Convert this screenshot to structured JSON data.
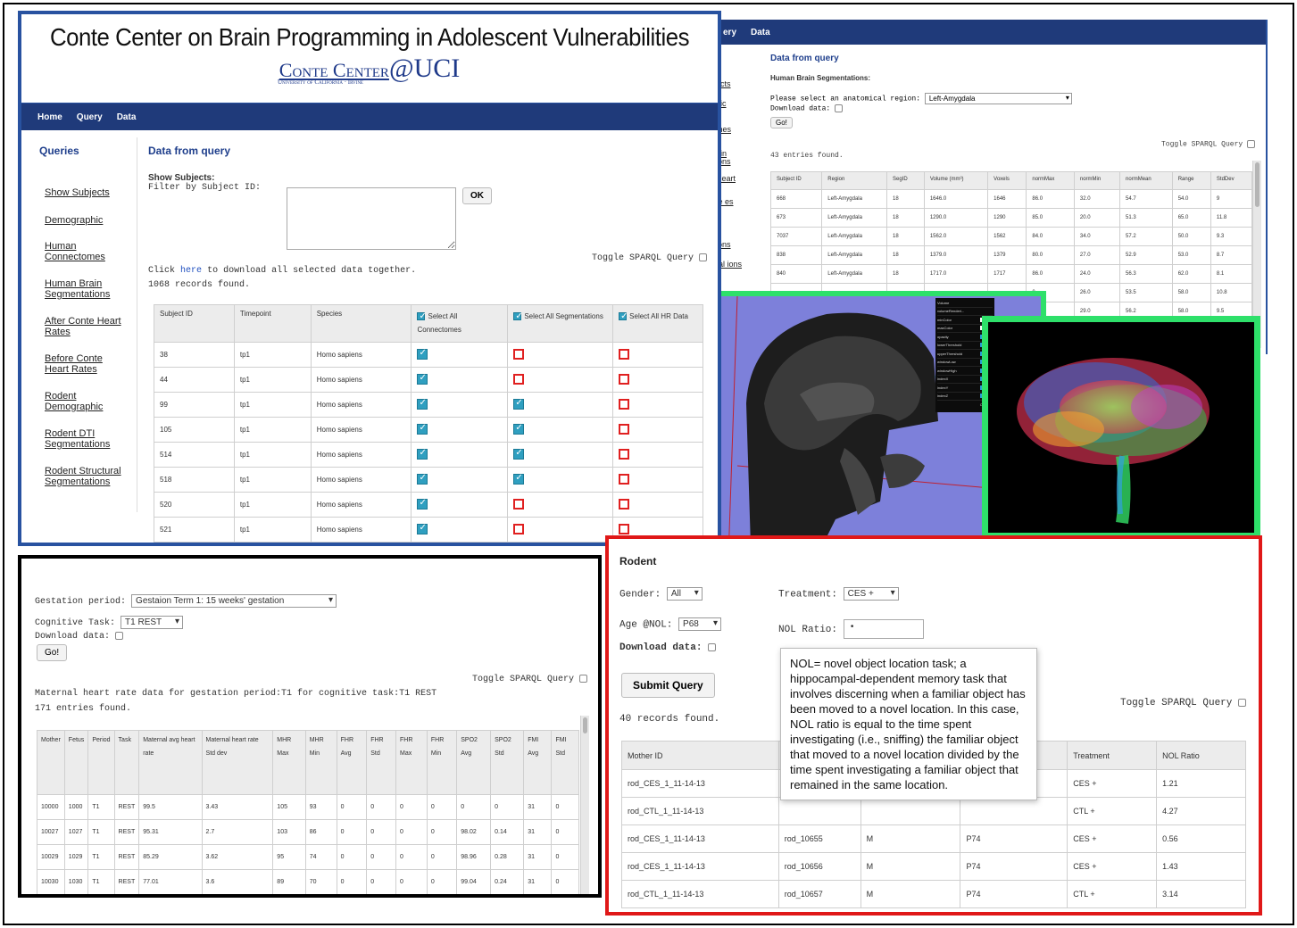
{
  "conte": {
    "title": "Conte Center on Brain Programming in Adolescent Vulnerabilities",
    "logo_conte": "Conte Center",
    "logo_uci": "@UCI",
    "logo_sub": "University of California · Irvine",
    "nav": [
      "Home",
      "Query",
      "Data"
    ],
    "sidebar_title": "Queries",
    "sidebar_items": [
      "Show Subjects",
      "Demographic",
      "Human Connectomes",
      "Human Brain Segmentations",
      "After Conte Heart Rates",
      "Before Conte Heart Rates",
      "Rodent Demographic",
      "Rodent DTI Segmentations",
      "Rodent Structural Segmentations"
    ],
    "heading": "Data from query",
    "show_subjects": "Show Subjects:",
    "filter_label": "Filter by Subject ID:",
    "ok_label": "OK",
    "toggle_sparql": "Toggle SPARQL Query",
    "click_prefix": "Click",
    "click_link": "here",
    "click_suffix": "to download all selected data together.",
    "records_found": "1068 records found.",
    "columns": [
      "Subject ID",
      "Timepoint",
      "Species"
    ],
    "select_all": [
      "Select All Connectomes",
      "Select All Segmentations",
      "Select All HR Data"
    ],
    "rows": [
      {
        "id": "38",
        "tp": "tp1",
        "species": "Homo sapiens",
        "c": true,
        "s": false,
        "h": false
      },
      {
        "id": "44",
        "tp": "tp1",
        "species": "Homo sapiens",
        "c": true,
        "s": false,
        "h": false
      },
      {
        "id": "99",
        "tp": "tp1",
        "species": "Homo sapiens",
        "c": true,
        "s": true,
        "h": false
      },
      {
        "id": "105",
        "tp": "tp1",
        "species": "Homo sapiens",
        "c": true,
        "s": true,
        "h": false
      },
      {
        "id": "514",
        "tp": "tp1",
        "species": "Homo sapiens",
        "c": true,
        "s": true,
        "h": false
      },
      {
        "id": "518",
        "tp": "tp1",
        "species": "Homo sapiens",
        "c": true,
        "s": true,
        "h": false
      },
      {
        "id": "520",
        "tp": "tp1",
        "species": "Homo sapiens",
        "c": true,
        "s": false,
        "h": false
      },
      {
        "id": "521",
        "tp": "tp1",
        "species": "Homo sapiens",
        "c": true,
        "s": false,
        "h": false
      }
    ]
  },
  "seg": {
    "nav": [
      "ery",
      "Data"
    ],
    "side_fragments": [
      "ects",
      "hic",
      "mes",
      "ain ions",
      "Heart",
      "te es",
      "ions",
      "ral ions"
    ],
    "heading": "Data from query",
    "subheading": "Human Brain Segmentations:",
    "region_label": "Please select an anatomical region:",
    "region_value": "Left-Amygdala",
    "download_label": "Download data:",
    "go_label": "Go!",
    "toggle_sparql": "Toggle SPARQL Query",
    "entries_found": "43 entries found.",
    "columns": [
      "Subject ID",
      "Region",
      "SegID",
      "Volume (mm³)",
      "Voxels",
      "normMax",
      "normMin",
      "normMean",
      "Range",
      "StdDev"
    ],
    "rows": [
      [
        "668",
        "Left-Amygdala",
        "18",
        "1646.0",
        "1646",
        "86.0",
        "32.0",
        "54.7",
        "54.0",
        "9"
      ],
      [
        "673",
        "Left-Amygdala",
        "18",
        "1290.0",
        "1290",
        "85.0",
        "20.0",
        "51.3",
        "65.0",
        "11.8"
      ],
      [
        "7037",
        "Left-Amygdala",
        "18",
        "1562.0",
        "1562",
        "84.0",
        "34.0",
        "57.2",
        "50.0",
        "9.3"
      ],
      [
        "838",
        "Left-Amygdala",
        "18",
        "1379.0",
        "1379",
        "80.0",
        "27.0",
        "52.9",
        "53.0",
        "8.7"
      ],
      [
        "840",
        "Left-Amygdala",
        "18",
        "1717.0",
        "1717",
        "86.0",
        "24.0",
        "56.3",
        "62.0",
        "8.1"
      ],
      [
        "",
        "",
        "",
        "",
        "",
        "0",
        "26.0",
        "53.5",
        "58.0",
        "10.8"
      ],
      [
        "",
        "",
        "",
        "",
        "",
        "0",
        "29.0",
        "56.2",
        "58.0",
        "9.5"
      ]
    ]
  },
  "viewer": {
    "panel_items": [
      "Volume",
      "volumeRenderi...",
      "minColor",
      "maxColor",
      "opacity",
      "lowerThreshold",
      "upperThreshold",
      "windowLow",
      "windowHigh",
      "indexX",
      "indexY",
      "indexZ"
    ],
    "close_label": "Close C"
  },
  "hr": {
    "gestation_label": "Gestation period:",
    "gestation_value": "Gestaion Term 1: 15 weeks' gestation",
    "task_label": "Cognitive Task:",
    "task_value": "T1 REST",
    "download_label": "Download data:",
    "go_label": "Go!",
    "toggle_sparql": "Toggle SPARQL Query",
    "caption": "Maternal heart rate data for gestation period:T1 for cognitive task:T1 REST",
    "entries_found": "171 entries found.",
    "columns": [
      "Mother",
      "Fetus",
      "Period",
      "Task",
      "Maternal avg heart rate",
      "Maternal heart rate Std dev",
      "MHR Max",
      "MHR Min",
      "FHR Avg",
      "FHR Std",
      "FHR Max",
      "FHR Min",
      "SPO2 Avg",
      "SPO2 Std",
      "FMI Avg",
      "FMI Std"
    ],
    "rows": [
      [
        "10000",
        "1000",
        "T1",
        "REST",
        "99.5",
        "3.43",
        "105",
        "93",
        "0",
        "0",
        "0",
        "0",
        "0",
        "0",
        "31",
        "0"
      ],
      [
        "10027",
        "1027",
        "T1",
        "REST",
        "95.31",
        "2.7",
        "103",
        "86",
        "0",
        "0",
        "0",
        "0",
        "98.02",
        "0.14",
        "31",
        "0"
      ],
      [
        "10029",
        "1029",
        "T1",
        "REST",
        "85.29",
        "3.62",
        "95",
        "74",
        "0",
        "0",
        "0",
        "0",
        "98.96",
        "0.28",
        "31",
        "0"
      ],
      [
        "10030",
        "1030",
        "T1",
        "REST",
        "77.01",
        "3.6",
        "89",
        "70",
        "0",
        "0",
        "0",
        "0",
        "99.04",
        "0.24",
        "31",
        "0"
      ]
    ]
  },
  "rodent": {
    "title": "Rodent",
    "gender_label": "Gender:",
    "gender_value": "All",
    "treatment_label": "Treatment:",
    "treatment_value": "CES +",
    "age_label": "Age @NOL:",
    "age_value": "P68",
    "nol_label": "NOL Ratio:",
    "nol_value": "•",
    "download_label": "Download data:",
    "submit_label": "Submit Query",
    "toggle_sparql": "Toggle SPARQL Query",
    "records_found": "40 records found.",
    "tooltip": "NOL= novel object location task; a hippocampal-dependent memory task that involves discerning when a familiar object has been moved to a novel location. In this case, NOL ratio is equal to the time spent investigating (i.e., sniffing) the familiar object that moved to a novel location divided by the time spent investigating a familiar object that remained in the same location.",
    "columns": [
      "Mother ID",
      "",
      "",
      "",
      "Treatment",
      "NOL Ratio"
    ],
    "rows": [
      [
        "rod_CES_1_11-14-13",
        "",
        "",
        "",
        "CES +",
        "1.21"
      ],
      [
        "rod_CTL_1_11-14-13",
        "",
        "",
        "",
        "CTL +",
        "4.27"
      ],
      [
        "rod_CES_1_11-14-13",
        "rod_10655",
        "M",
        "P74",
        "CES +",
        "0.56"
      ],
      [
        "rod_CES_1_11-14-13",
        "rod_10656",
        "M",
        "P74",
        "CES +",
        "1.43"
      ],
      [
        "rod_CTL_1_11-14-13",
        "rod_10657",
        "M",
        "P74",
        "CTL +",
        "3.14"
      ]
    ]
  },
  "colors": {
    "navy": "#1f3a7a",
    "frame_blue": "#2852a0",
    "frame_green": "#2ee06a",
    "frame_red": "#e01818",
    "frame_black": "#000000",
    "heading_blue": "#1f3f8c"
  }
}
